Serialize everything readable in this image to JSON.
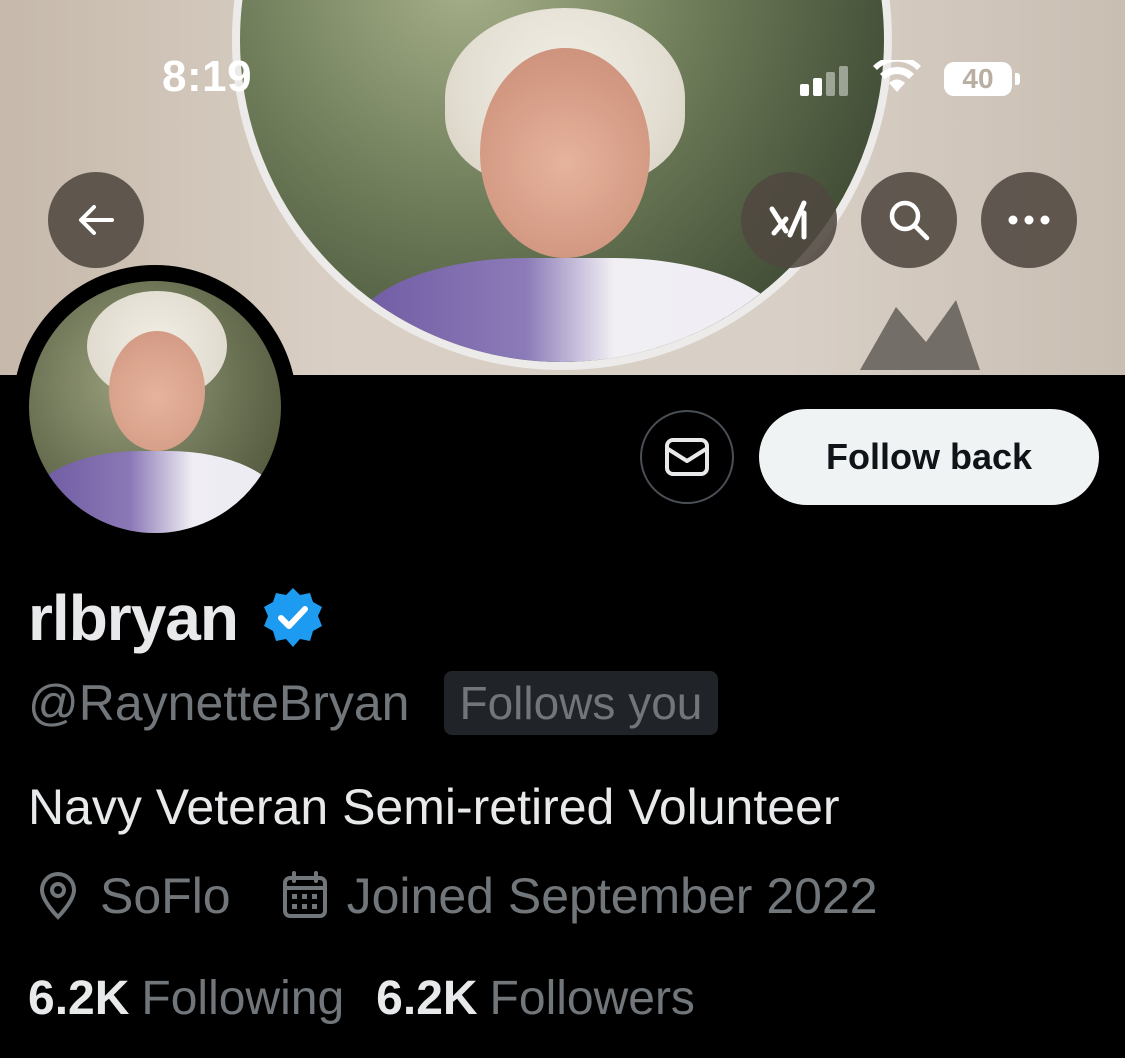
{
  "status_bar": {
    "time": "8:19",
    "battery": "40"
  },
  "nav": {
    "back_icon": "arrow-left-icon",
    "grok_icon": "grok-icon",
    "search_icon": "search-icon",
    "more_icon": "more-icon"
  },
  "profile": {
    "display_name": "rlbryan",
    "handle": "@RaynetteBryan",
    "follows_you_label": "Follows you",
    "bio": "Navy Veteran Semi-retired Volunteer",
    "location": "SoFlo",
    "joined": "Joined September 2022",
    "following_count": "6.2K",
    "following_label": "Following",
    "followers_count": "6.2K",
    "followers_label": "Followers",
    "verified_color": "#1d9bf0"
  },
  "actions": {
    "follow_label": "Follow back",
    "message_icon": "mail-icon"
  }
}
